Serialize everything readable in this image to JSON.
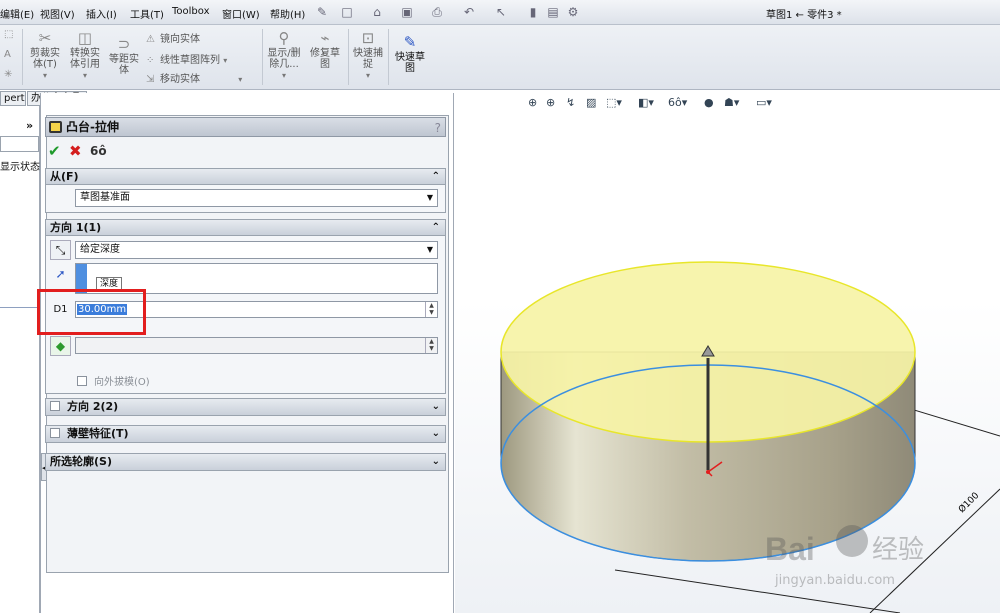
{
  "menu": {
    "items": [
      "编辑(E)",
      "视图(V)",
      "插入(I)",
      "工具(T)",
      "Toolbox",
      "窗口(W)",
      "帮助(H)"
    ],
    "document_title": "草图1 ← 零件3 *"
  },
  "ribbon": {
    "trim": "剪裁实\n体(T)",
    "convert": "转换实\n体引用",
    "offset": "等距实\n体",
    "mirror": "镜向实体",
    "linear_pattern": "线性草图阵列",
    "move": "移动实体",
    "show_delete": "显示/删\n除几...",
    "repair": "修复草\n图",
    "quick_snap": "快速捕\n捉",
    "rapid_sketch": "快速草\n图"
  },
  "tabs": {
    "left": "pert",
    "office": "办公室产品"
  },
  "left_panel": {
    "display_state": "显示状态"
  },
  "property_manager": {
    "title": "凸台-拉伸",
    "help": "?",
    "from": {
      "header": "从(F)",
      "value": "草图基准面"
    },
    "direction1": {
      "header": "方向 1(1)",
      "end_condition": "给定深度",
      "tooltip": "深度",
      "depth": "30.00mm",
      "draft_outward": "向外拔模(O)"
    },
    "direction2": {
      "header": "方向 2(2)"
    },
    "thin_feature": {
      "header": "薄壁特征(T)"
    },
    "selected_contours": {
      "header": "所选轮廓(S)"
    }
  },
  "dimension_label": "Ø100",
  "watermark": {
    "brand": "Bai",
    "brand_cn": "经验",
    "url": "jingyan.baidu.com"
  },
  "colors": {
    "top_face": "#f6f3a6",
    "side_face": "#bdb7a3",
    "highlight": "#e21e1e",
    "selection": "#3b7ddb"
  }
}
